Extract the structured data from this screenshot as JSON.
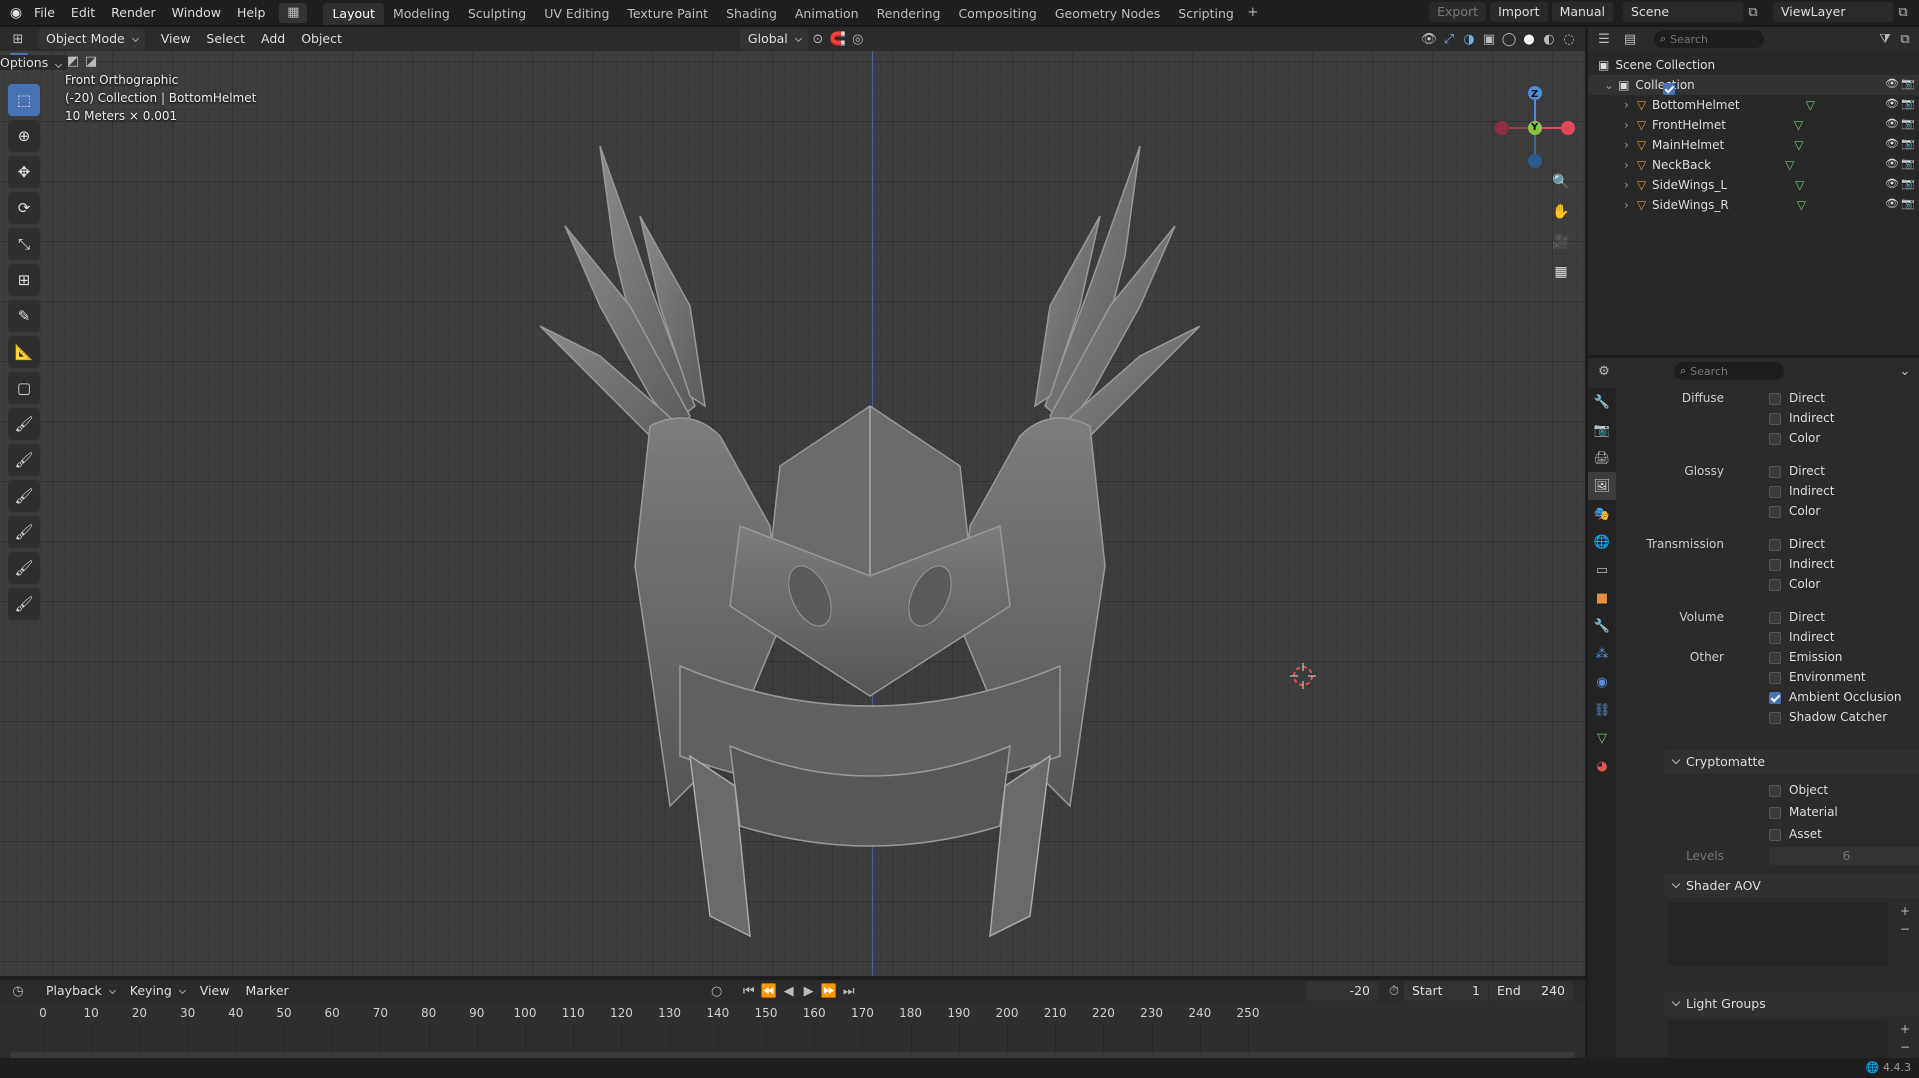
{
  "menus": [
    "File",
    "Edit",
    "Render",
    "Window",
    "Help"
  ],
  "workspace_tabs": [
    "Layout",
    "Modeling",
    "Sculpting",
    "UV Editing",
    "Texture Paint",
    "Shading",
    "Animation",
    "Rendering",
    "Compositing",
    "Geometry Nodes",
    "Scripting"
  ],
  "active_tab": "Layout",
  "top_right": {
    "export": "Export",
    "import": "Import",
    "manual": "Manual",
    "scene": "Scene",
    "view_layer": "ViewLayer"
  },
  "viewport_header": {
    "mode": "Object Mode",
    "menus": [
      "View",
      "Select",
      "Add",
      "Object"
    ],
    "orientation": "Global",
    "options": "Options"
  },
  "viewport_info": {
    "line1": "Front Orthographic",
    "line2": "(-20) Collection | BottomHelmet",
    "line3": "10 Meters × 0.001"
  },
  "gizmo": {
    "z": "Z",
    "y": "Y"
  },
  "outliner": {
    "search_placeholder": "Search",
    "scene_collection": "Scene Collection",
    "collection": "Collection",
    "objects": [
      "BottomHelmet",
      "FrontHelmet",
      "MainHelmet",
      "NeckBack",
      "SideWings_L",
      "SideWings_R"
    ]
  },
  "properties": {
    "search_placeholder": "Search",
    "passes": [
      {
        "group": "Diffuse",
        "items": [
          {
            "label": "Direct",
            "checked": false
          },
          {
            "label": "Indirect",
            "checked": false
          },
          {
            "label": "Color",
            "checked": false
          }
        ]
      },
      {
        "group": "Glossy",
        "items": [
          {
            "label": "Direct",
            "checked": false
          },
          {
            "label": "Indirect",
            "checked": false
          },
          {
            "label": "Color",
            "checked": false
          }
        ]
      },
      {
        "group": "Transmission",
        "items": [
          {
            "label": "Direct",
            "checked": false
          },
          {
            "label": "Indirect",
            "checked": false
          },
          {
            "label": "Color",
            "checked": false
          }
        ]
      },
      {
        "group": "Volume",
        "items": [
          {
            "label": "Direct",
            "checked": false
          },
          {
            "label": "Indirect",
            "checked": false
          }
        ]
      },
      {
        "group": "Other",
        "items": [
          {
            "label": "Emission",
            "checked": false
          },
          {
            "label": "Environment",
            "checked": false
          },
          {
            "label": "Ambient Occlusion",
            "checked": true
          },
          {
            "label": "Shadow Catcher",
            "checked": false
          }
        ]
      }
    ],
    "cryptomatte": {
      "title": "Cryptomatte",
      "items": [
        "Object",
        "Material",
        "Asset"
      ],
      "levels_label": "Levels",
      "levels_value": "6"
    },
    "shader_aov": "Shader AOV",
    "light_groups": "Light Groups"
  },
  "timeline": {
    "menus": [
      "Playback",
      "Keying",
      "View",
      "Marker"
    ],
    "current_frame": "-20",
    "start_label": "Start",
    "start": "1",
    "end_label": "End",
    "end": "240",
    "ruler": [
      "0",
      "10",
      "20",
      "30",
      "40",
      "50",
      "60",
      "70",
      "80",
      "90",
      "100",
      "110",
      "120",
      "130",
      "140",
      "150",
      "160",
      "170",
      "180",
      "190",
      "200",
      "210",
      "220",
      "230",
      "240",
      "250"
    ]
  },
  "status": {
    "version": "4.4.3"
  },
  "colors": {
    "accent": "#4772b3",
    "x_axis": "#e4475b",
    "y_axis": "#8bc543",
    "z_axis": "#4a8fdc",
    "object_orange": "#e8903a",
    "mesh_green": "#6fcf6f"
  }
}
